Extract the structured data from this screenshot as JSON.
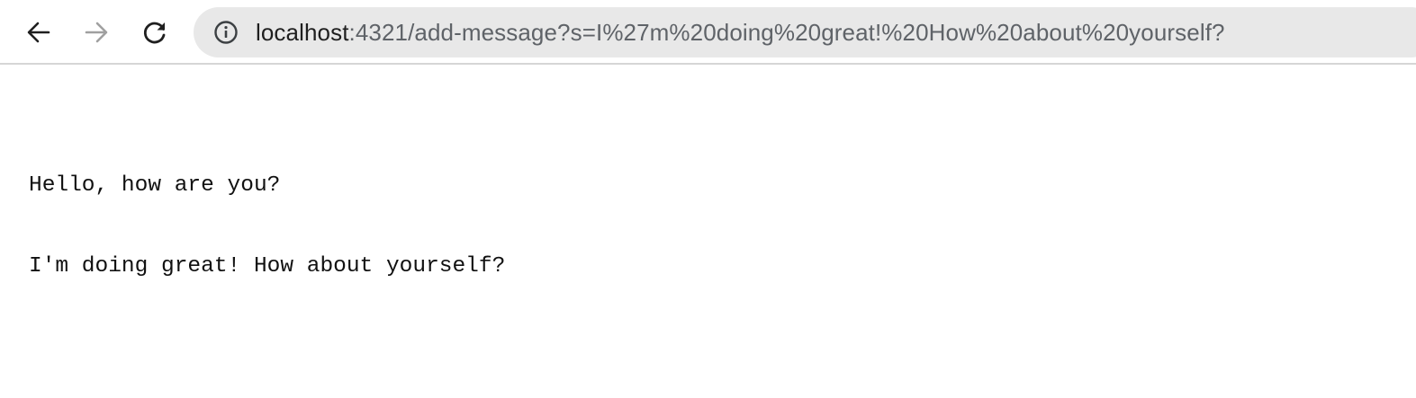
{
  "browser": {
    "back_icon": "arrow-left-icon",
    "forward_icon": "arrow-right-icon",
    "reload_icon": "reload-icon",
    "info_icon": "info-icon",
    "url_host": "localhost",
    "url_path": ":4321/add-message?s=I%27m%20doing%20great!%20How%20about%20yourself?",
    "colors": {
      "toolbar_bg": "#ffffff",
      "omnibox_bg": "#e8e8e8",
      "host_text": "#1f1f1f",
      "path_text": "#5f6368",
      "disabled_icon": "#a0a0a0"
    }
  },
  "page": {
    "messages": [
      "Hello, how are you?",
      "I'm doing great! How about yourself?"
    ]
  }
}
